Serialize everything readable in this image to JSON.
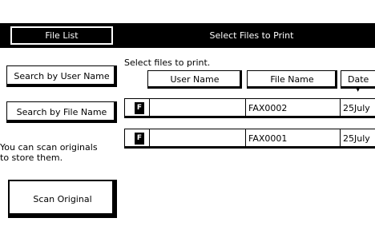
{
  "sidebar": {
    "file_list_tab": "File List",
    "search_user_button": "Search by User Name",
    "search_file_button": "Search by  File Name",
    "info_line1": "You can scan originals",
    "info_line2": "to store them.",
    "scan_button": "Scan Original"
  },
  "main": {
    "title": "Select Files to Print",
    "instruction": "Select files to print.",
    "columns": [
      "User Name",
      "File Name",
      "Date"
    ],
    "rows": [
      {
        "icon": "fax-file-icon",
        "icon_glyph": "F",
        "user": "",
        "file": "FAX0002",
        "date": "25July"
      },
      {
        "icon": "fax-file-icon",
        "icon_glyph": "F",
        "user": "",
        "file": "FAX0001",
        "date": "25July"
      }
    ],
    "sort_indicator": "▼"
  }
}
